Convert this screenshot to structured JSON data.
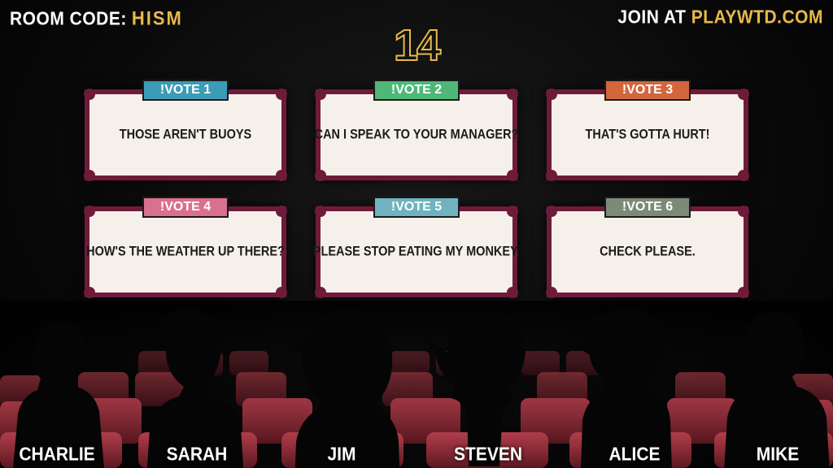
{
  "header": {
    "room_label": "ROOM CODE:",
    "room_code": "HISM",
    "join_label": "JOIN AT",
    "join_url": "PLAYWTD.COM"
  },
  "timer": "14",
  "cards": [
    {
      "tag": "!VOTE 1",
      "text": "THOSE AREN'T BUOYS",
      "tag_color": "#3b9cb7"
    },
    {
      "tag": "!VOTE 2",
      "text": "CAN I SPEAK TO YOUR MANAGER?",
      "tag_color": "#4fb879"
    },
    {
      "tag": "!VOTE 3",
      "text": "THAT'S GOTTA HURT!",
      "tag_color": "#d3663c"
    },
    {
      "tag": "!VOTE 4",
      "text": "HOW'S THE WEATHER UP THERE?",
      "tag_color": "#d9708f"
    },
    {
      "tag": "!VOTE 5",
      "text": "PLEASE STOP EATING MY MONKEY.",
      "tag_color": "#6fb3c0"
    },
    {
      "tag": "!VOTE 6",
      "text": "CHECK PLEASE.",
      "tag_color": "#7d8a78"
    }
  ],
  "players": [
    "CHARLIE",
    "SARAH",
    "JIM",
    "STEVEN",
    "ALICE",
    "MIKE"
  ],
  "colors": {
    "gold": "#e8b84a",
    "card_border": "#6e1b3a",
    "card_bg": "#f6f0ea",
    "seat": "#b83a47"
  }
}
